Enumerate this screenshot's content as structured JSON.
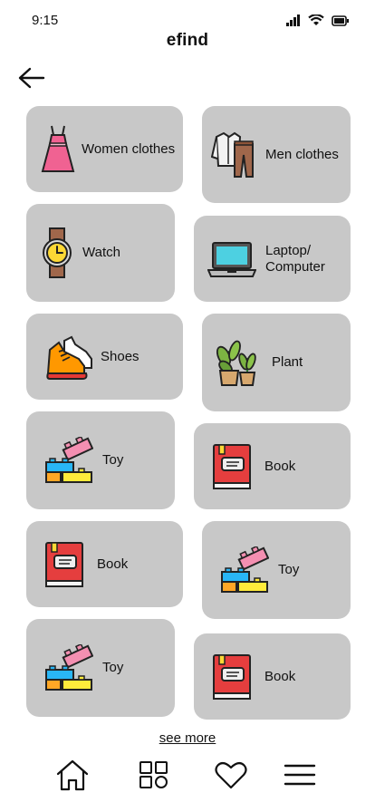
{
  "status_bar": {
    "time": "9:15",
    "icons": [
      "signal-icon",
      "wifi-icon",
      "battery-icon"
    ]
  },
  "header": {
    "title": "efind",
    "back_icon": "arrow-left-icon"
  },
  "categories": [
    {
      "label": "Women clothes",
      "icon": "dress-icon"
    },
    {
      "label": "Men clothes",
      "icon": "shirt-pants-icon"
    },
    {
      "label": "Watch",
      "icon": "watch-icon"
    },
    {
      "label": "Laptop/\nComputer",
      "icon": "laptop-icon"
    },
    {
      "label": "Shoes",
      "icon": "shoes-icon"
    },
    {
      "label": "Plant",
      "icon": "plant-icon"
    },
    {
      "label": "Toy",
      "icon": "toy-blocks-icon"
    },
    {
      "label": "Book",
      "icon": "book-icon"
    },
    {
      "label": "Book",
      "icon": "book-icon"
    },
    {
      "label": "Toy",
      "icon": "toy-blocks-icon"
    },
    {
      "label": "Toy",
      "icon": "toy-blocks-icon"
    },
    {
      "label": "Book",
      "icon": "book-icon"
    }
  ],
  "see_more": "see more",
  "bottom_nav": [
    "home-icon",
    "categories-grid-icon",
    "heart-icon",
    "menu-icon"
  ],
  "colors": {
    "card": "#c8c8c8",
    "background": "#ffffff",
    "text": "#111111"
  }
}
